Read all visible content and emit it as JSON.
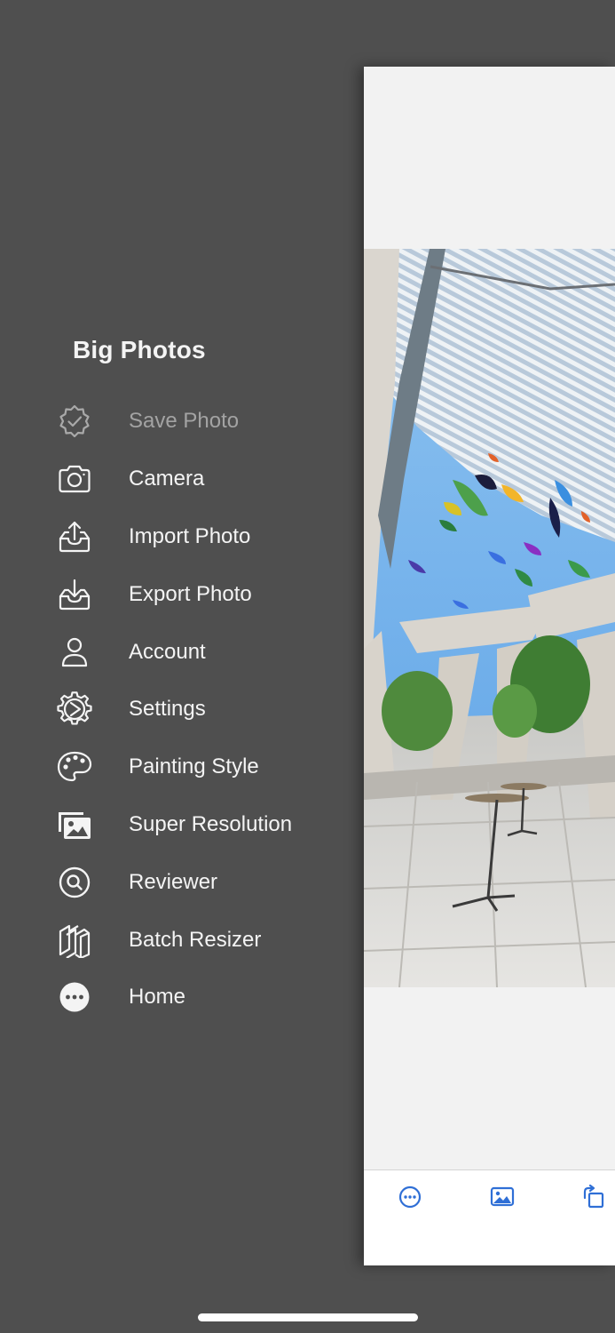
{
  "drawer": {
    "title": "Big Photos",
    "items": [
      {
        "label": "Save Photo",
        "icon": "badge-check-icon",
        "disabled": true
      },
      {
        "label": "Camera",
        "icon": "camera-icon"
      },
      {
        "label": "Import Photo",
        "icon": "tray-upload-icon"
      },
      {
        "label": "Export Photo",
        "icon": "tray-download-icon"
      },
      {
        "label": "Account",
        "icon": "person-icon"
      },
      {
        "label": "Settings",
        "icon": "gear-icon"
      },
      {
        "label": "Painting Style",
        "icon": "palette-icon"
      },
      {
        "label": "Super Resolution",
        "icon": "photo-stack-icon"
      },
      {
        "label": "Reviewer",
        "icon": "magnifier-circle-icon"
      },
      {
        "label": "Batch Resizer",
        "icon": "layers-icon"
      },
      {
        "label": "Home",
        "icon": "ellipsis-circle-icon"
      }
    ]
  },
  "toolbar": {
    "buttons": [
      {
        "name": "more-button",
        "icon": "ellipsis-circle-icon"
      },
      {
        "name": "photo-library-button",
        "icon": "photo-icon"
      },
      {
        "name": "rotate-button",
        "icon": "rotate-icon"
      }
    ]
  },
  "colors": {
    "drawer_background": "#4f4f4f",
    "drawer_text": "#f4f4f4",
    "disabled_text": "#a3a3a3",
    "toolbar_accent": "#2f6fd6",
    "canvas_background": "#f2f2f2"
  }
}
